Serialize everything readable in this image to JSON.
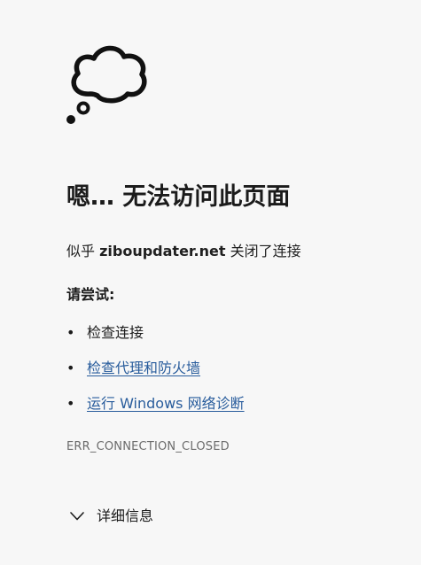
{
  "icon": "cloud-thought-icon",
  "title": "嗯… 无法访问此页面",
  "message": {
    "prefix": "似乎 ",
    "host": "ziboupdater.net",
    "suffix": " 关闭了连接"
  },
  "try_heading": "请尝试:",
  "suggestions": [
    {
      "bullet": "•",
      "label": "检查连接",
      "link": false
    },
    {
      "bullet": "•",
      "label": "检查代理和防火墙",
      "link": true
    },
    {
      "bullet": "•",
      "label": "运行 Windows 网络诊断",
      "link": true
    }
  ],
  "error_code": "ERR_CONNECTION_CLOSED",
  "details": {
    "label": "详细信息",
    "icon": "chevron-down-icon"
  },
  "colors": {
    "background": "#f7f7f7",
    "link": "#285c9c",
    "muted": "#6b6b6b"
  }
}
